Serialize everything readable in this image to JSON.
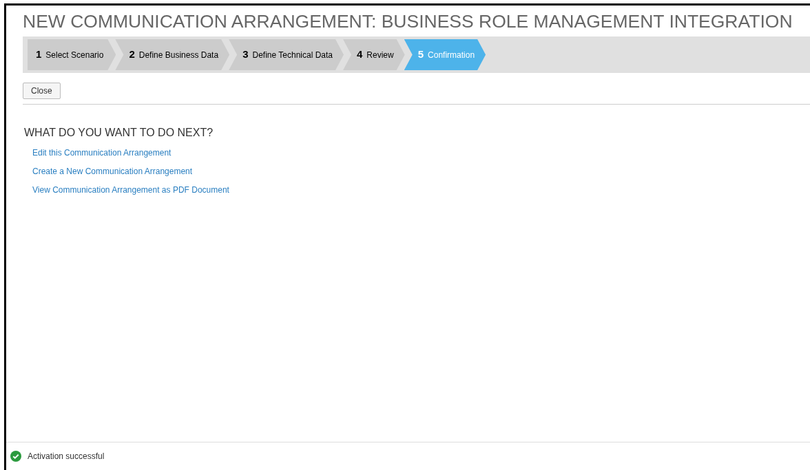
{
  "title": "NEW COMMUNICATION ARRANGEMENT: BUSINESS ROLE MANAGEMENT INTEGRATION",
  "steps": [
    {
      "number": "1",
      "label": "Select Scenario",
      "selected": false
    },
    {
      "number": "2",
      "label": "Define Business Data",
      "selected": false
    },
    {
      "number": "3",
      "label": "Define Technical Data",
      "selected": false
    },
    {
      "number": "4",
      "label": "Review",
      "selected": false
    },
    {
      "number": "5",
      "label": "Confirmation",
      "selected": true
    }
  ],
  "close_button": "Close",
  "next_heading": "WHAT DO YOU WANT TO DO NEXT?",
  "links": [
    "Edit this Communication Arrangement",
    "Create a New Communication Arrangement",
    "View Communication Arrangement as PDF Document"
  ],
  "status": {
    "kind": "success",
    "message": "Activation successful"
  }
}
